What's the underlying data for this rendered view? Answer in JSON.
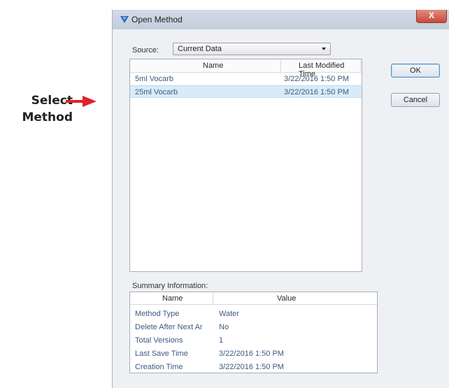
{
  "callout": {
    "line1": "Select",
    "line2": "Method",
    "arrow_color": "#e0222a"
  },
  "dialog": {
    "title": "Open Method",
    "close_glyph": "X",
    "source_label": "Source:",
    "source_value": "Current Data",
    "list_headers": {
      "name": "Name",
      "modified": "Last Modified Time"
    },
    "methods": [
      {
        "name": "5ml Vocarb",
        "modified": "3/22/2016 1:50 PM",
        "selected": false
      },
      {
        "name": "25ml Vocarb",
        "modified": "3/22/2016 1:50 PM",
        "selected": true
      }
    ],
    "ok_label": "OK",
    "cancel_label": "Cancel",
    "summary_label": "Summary Information:",
    "summary_headers": {
      "name": "Name",
      "value": "Value"
    },
    "summary_rows": [
      {
        "name": "Method Type",
        "value": "Water"
      },
      {
        "name": "Delete After Next Ar",
        "value": "No"
      },
      {
        "name": "Total Versions",
        "value": "1"
      },
      {
        "name": "Last Save Time",
        "value": "3/22/2016 1:50 PM"
      },
      {
        "name": "Creation Time",
        "value": "3/22/2016 1:50 PM"
      }
    ]
  }
}
